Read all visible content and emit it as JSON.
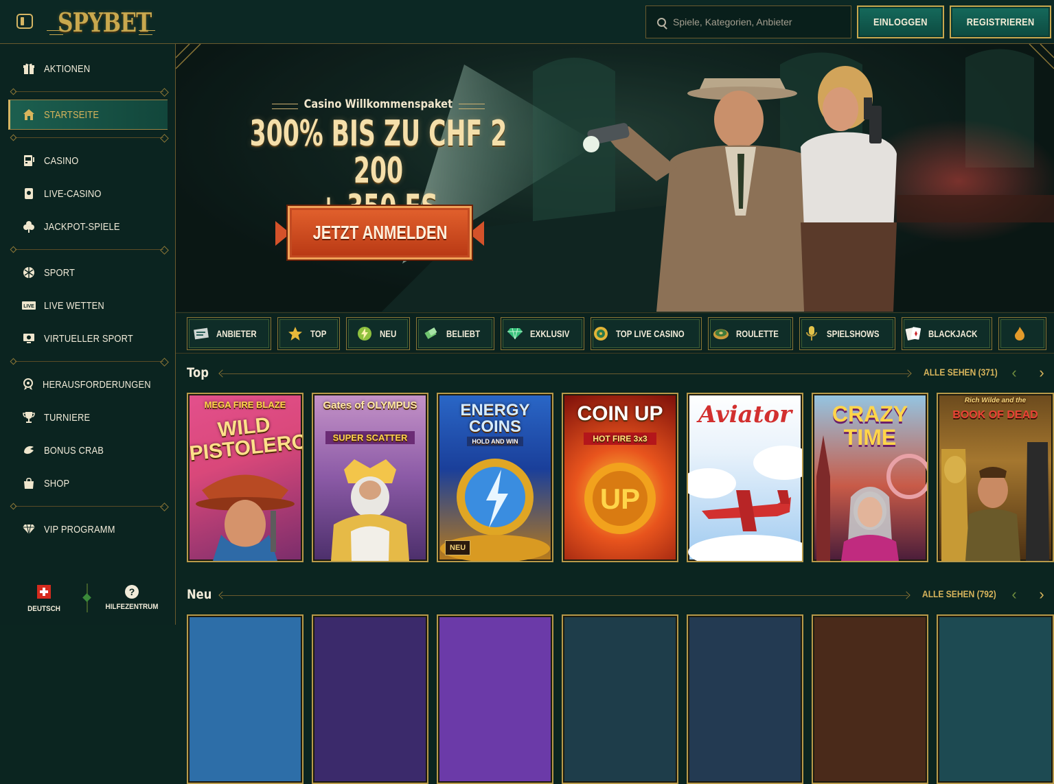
{
  "header": {
    "logo_text": "SPYBET",
    "search_placeholder": "Spiele, Kategorien, Anbieter",
    "login_label": "EINLOGGEN",
    "register_label": "REGISTRIEREN"
  },
  "sidebar": {
    "items": [
      {
        "label": "AKTIONEN",
        "icon": "gift-icon",
        "active": false
      },
      {
        "label": "STARTSEITE",
        "icon": "home-icon",
        "active": true
      },
      {
        "label": "CASINO",
        "icon": "slot-machine-icon",
        "active": false
      },
      {
        "label": "LIVE-CASINO",
        "icon": "playing-card-icon",
        "active": false
      },
      {
        "label": "JACKPOT-SPIELE",
        "icon": "clover-icon",
        "active": false
      },
      {
        "label": "SPORT",
        "icon": "soccer-ball-icon",
        "active": false
      },
      {
        "label": "LIVE WETTEN",
        "icon": "live-icon",
        "active": false
      },
      {
        "label": "VIRTUELLER SPORT",
        "icon": "virtual-sport-icon",
        "active": false
      },
      {
        "label": "HERAUSFORDERUNGEN",
        "icon": "award-icon",
        "active": false
      },
      {
        "label": "TURNIERE",
        "icon": "trophy-icon",
        "active": false
      },
      {
        "label": "BONUS CRAB",
        "icon": "crab-claw-icon",
        "active": false
      },
      {
        "label": "SHOP",
        "icon": "shopping-bag-icon",
        "active": false
      },
      {
        "label": "VIP PROGRAMM",
        "icon": "diamond-icon",
        "active": false
      }
    ],
    "footer": {
      "language_label": "DEUTSCH",
      "help_label": "HILFEZENTRUM"
    }
  },
  "hero": {
    "subtitle": "Casino Willkommenspaket",
    "title_line1": "300% BIS ZU CHF 2 200",
    "title_line2": "+ 350 FS",
    "cta_label": "JETZT ANMELDEN"
  },
  "categories": [
    {
      "label": "ANBIETER",
      "icon": "provider-icon"
    },
    {
      "label": "TOP",
      "icon": "star-icon"
    },
    {
      "label": "NEU",
      "icon": "lightning-icon"
    },
    {
      "label": "BELIEBT",
      "icon": "popular-icon"
    },
    {
      "label": "EXKLUSIV",
      "icon": "gem-icon"
    },
    {
      "label": "TOP LIVE CASINO",
      "icon": "live-casino-icon"
    },
    {
      "label": "ROULETTE",
      "icon": "roulette-icon"
    },
    {
      "label": "SPIELSHOWS",
      "icon": "microphone-icon"
    },
    {
      "label": "BLACKJACK",
      "icon": "cards-icon"
    }
  ],
  "sections": {
    "top": {
      "title": "Top",
      "see_all": "ALLE SEHEN (371)"
    },
    "new": {
      "title": "Neu",
      "see_all": "ALLE SEHEN (792)"
    }
  },
  "games": [
    {
      "title": "WILD PISTOLERO",
      "subtitle": "MEGA FIRE BLAZE",
      "badge": ""
    },
    {
      "title": "Gates of OLYMPUS",
      "subtitle": "SUPER SCATTER",
      "badge": ""
    },
    {
      "title": "ENERGY COINS",
      "subtitle": "HOLD AND WIN",
      "badge": "NEU"
    },
    {
      "title": "COIN UP",
      "subtitle": "HOT FIRE 3x3",
      "badge": ""
    },
    {
      "title": "Aviator",
      "subtitle": "",
      "badge": ""
    },
    {
      "title": "CRAZY TIME",
      "subtitle": "",
      "badge": ""
    },
    {
      "title": "BOOK OF DEAD",
      "subtitle": "Rich Wilde and the",
      "badge": ""
    }
  ],
  "colors": {
    "accent_gold": "#d5b563",
    "bg_dark": "#0b2520",
    "button_teal": "#156a5c",
    "cta_orange": "#d4522a"
  }
}
